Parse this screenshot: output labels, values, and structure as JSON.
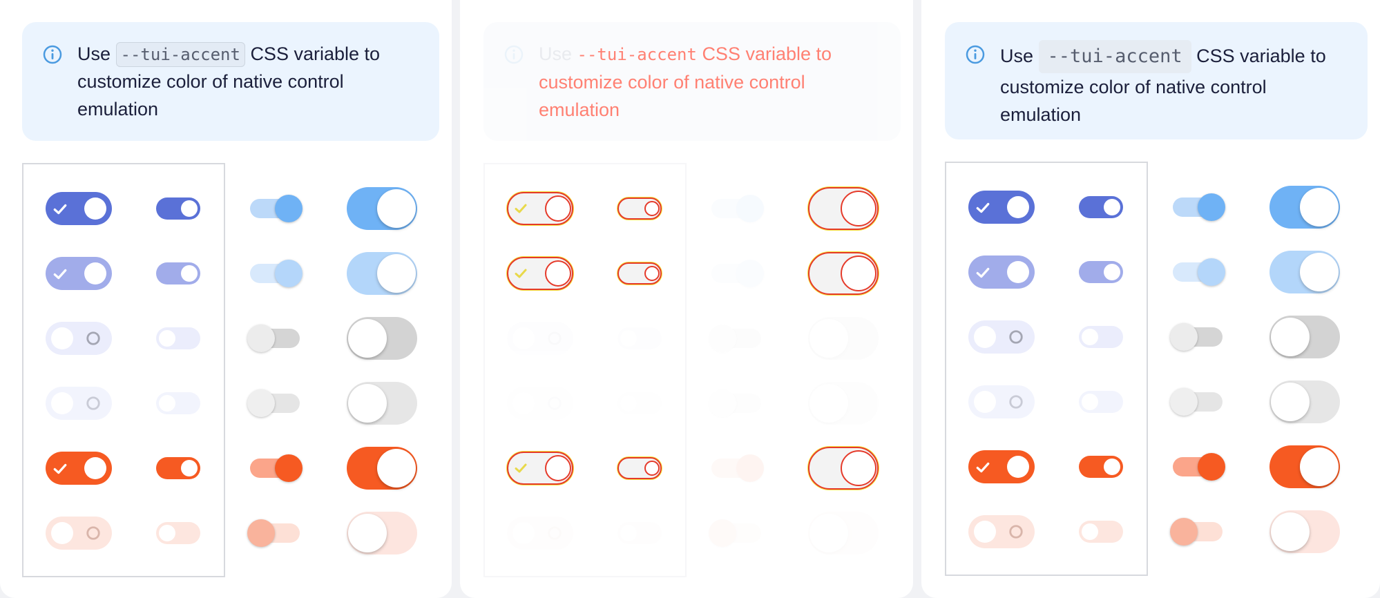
{
  "notice": {
    "prefix": "Use",
    "code": "--tui-accent",
    "suffix": "CSS variable to customize color of native control emulation"
  },
  "icons": {
    "info": "info-circle-icon",
    "check": "check-icon",
    "ring": "ring-icon"
  },
  "colors": {
    "accent_blue": "#5a71d7",
    "accent_light_blue": "#6fb2f5",
    "accent_orange": "#f65a22",
    "notice_bg": "#ebf4fe",
    "info_icon": "#4a9ae0"
  },
  "switch_rows": [
    {
      "state": "on",
      "variant": "accent"
    },
    {
      "state": "on",
      "variant": "accent-disabled"
    },
    {
      "state": "off",
      "variant": "default"
    },
    {
      "state": "off",
      "variant": "disabled"
    },
    {
      "state": "on",
      "variant": "error"
    },
    {
      "state": "off",
      "variant": "error-disabled"
    }
  ]
}
